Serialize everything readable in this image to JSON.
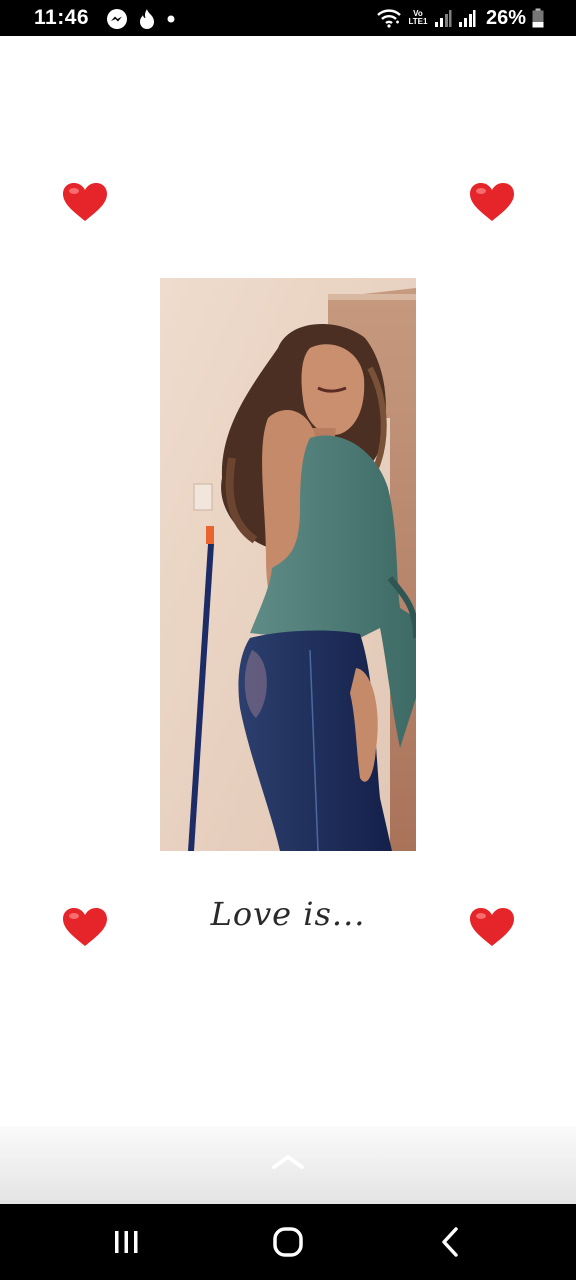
{
  "status_bar": {
    "time": "11:46",
    "icons_left": [
      "messenger-icon",
      "tinder-icon",
      "notification-dot-icon"
    ],
    "volte_label": "Vo\nLTE1",
    "icons_right": [
      "wifi-icon",
      "signal-icon",
      "signal-icon",
      "battery-icon"
    ],
    "battery": "26%"
  },
  "content": {
    "photo_description": "photo",
    "caption": "Love is..."
  },
  "decorations": {
    "heart_color": "#e5252a"
  },
  "nav_bar": {
    "buttons": [
      "recent-apps-icon",
      "home-icon",
      "back-icon"
    ]
  }
}
